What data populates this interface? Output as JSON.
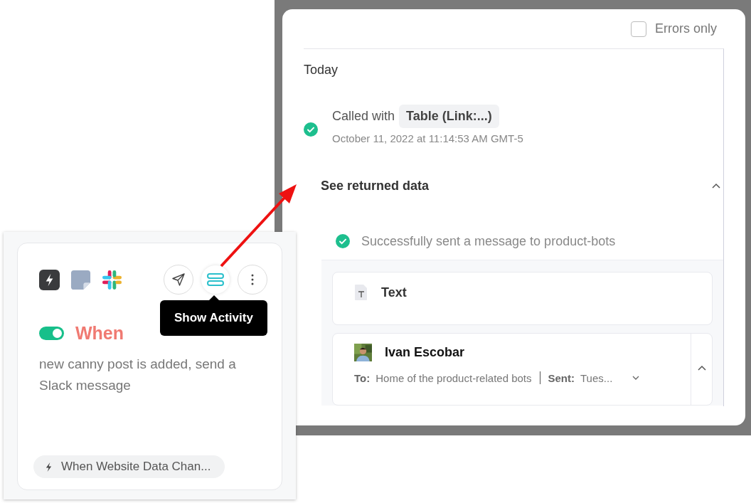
{
  "activity_panel": {
    "errors_only": {
      "label": "Errors only",
      "checked": false
    },
    "day_heading": "Today",
    "run": {
      "kind": "success",
      "called_with": "Called with",
      "argument": "Table (Link:...)",
      "timestamp": "October 11, 2022 at 11:14:53 AM GMT-5",
      "returned_data": {
        "label": "See returned data",
        "expanded": true,
        "result": {
          "kind": "success",
          "message": "Successfully sent a message to product-bots"
        },
        "fields": [
          {
            "kind": "text",
            "label": "Text"
          },
          {
            "kind": "message",
            "sender": "Ivan Escobar",
            "to_label": "To:",
            "to": "Home of the product-related bots",
            "sent_label": "Sent:",
            "sent": "Tues...",
            "expanded": true
          }
        ]
      }
    }
  },
  "automation_card": {
    "enabled": true,
    "tooltip": "Show Activity",
    "trigger_word": "When",
    "description": "new canny post is added, send a Slack message",
    "trigger_chip": "When Website Data Chan..."
  }
}
